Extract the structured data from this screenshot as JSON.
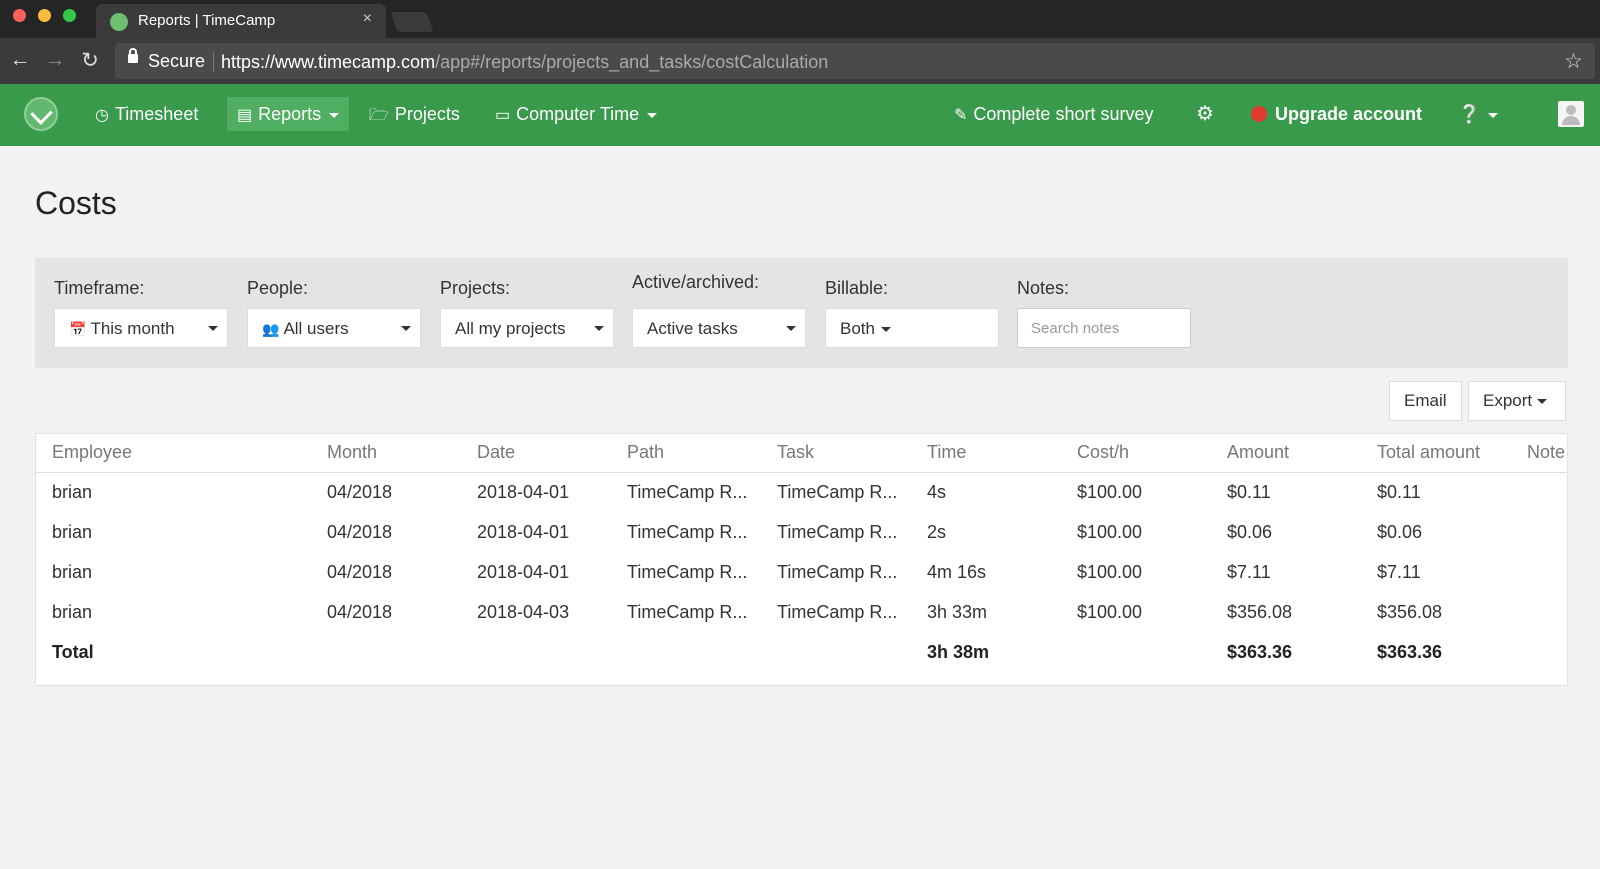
{
  "browser": {
    "tab_title": "Reports | TimeCamp",
    "tab_close": "×",
    "secure_label": "Secure",
    "url_host": "https://www.timecamp.com",
    "url_path": "/app#/reports/projects_and_tasks/costCalculation"
  },
  "navbar": {
    "timesheet": "Timesheet",
    "reports": "Reports",
    "projects": "Projects",
    "computer_time": "Computer Time",
    "survey": "Complete short survey",
    "upgrade": "Upgrade account"
  },
  "page": {
    "title": "Costs"
  },
  "filters": {
    "timeframe": {
      "label": "Timeframe:",
      "value": "This month"
    },
    "people": {
      "label": "People:",
      "value": "All users"
    },
    "projects": {
      "label": "Projects:",
      "value": "All my projects"
    },
    "active": {
      "label": "Active/archived:",
      "value": "Active tasks"
    },
    "billable": {
      "label": "Billable:",
      "value": "Both"
    },
    "notes": {
      "label": "Notes:",
      "placeholder": "Search notes"
    }
  },
  "actions": {
    "email": "Email",
    "export": "Export"
  },
  "table": {
    "headers": [
      "Employee",
      "Month",
      "Date",
      "Path",
      "Task",
      "Time",
      "Cost/h",
      "Amount",
      "Total amount",
      "Note"
    ],
    "rows": [
      [
        "brian",
        "04/2018",
        "2018-04-01",
        "TimeCamp R...",
        "TimeCamp R...",
        "4s",
        "$100.00",
        "$0.11",
        "$0.11",
        ""
      ],
      [
        "brian",
        "04/2018",
        "2018-04-01",
        "TimeCamp R...",
        "TimeCamp R...",
        "2s",
        "$100.00",
        "$0.06",
        "$0.06",
        ""
      ],
      [
        "brian",
        "04/2018",
        "2018-04-01",
        "TimeCamp R...",
        "TimeCamp R...",
        "4m 16s",
        "$100.00",
        "$7.11",
        "$7.11",
        ""
      ],
      [
        "brian",
        "04/2018",
        "2018-04-03",
        "TimeCamp R...",
        "TimeCamp R...",
        "3h 33m",
        "$100.00",
        "$356.08",
        "$356.08",
        ""
      ]
    ],
    "total": [
      "Total",
      "",
      "",
      "",
      "",
      "3h 38m",
      "",
      "$363.36",
      "$363.36",
      ""
    ]
  },
  "colors": {
    "navbar": "#3a9a4c",
    "nav_active": "#4fae61",
    "upgrade_dot": "#e03a2f"
  },
  "icons": [
    "clock-icon",
    "document-icon",
    "folder-icon",
    "laptop-icon",
    "edit-icon",
    "gear-icon",
    "question-icon",
    "calendar-icon",
    "users-icon",
    "star-icon",
    "lock-icon"
  ]
}
